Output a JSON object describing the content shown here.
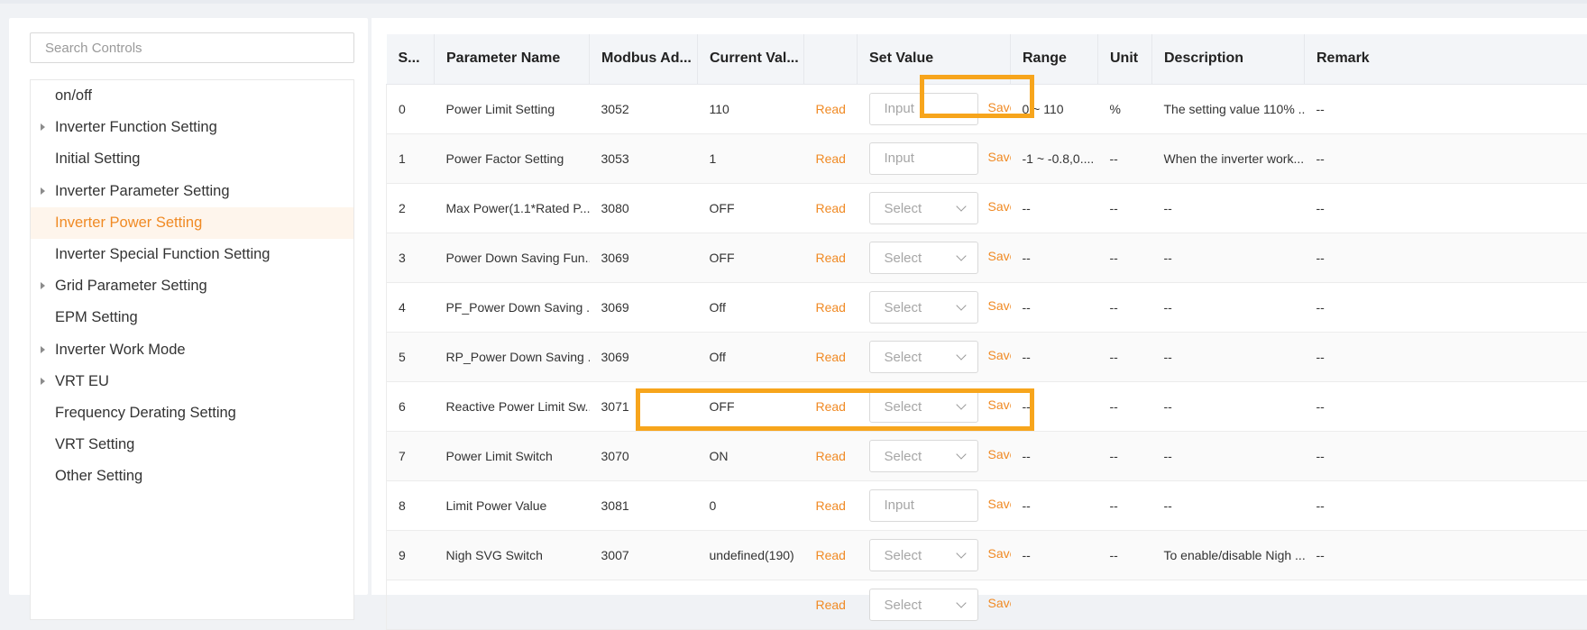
{
  "search": {
    "placeholder": "Search Controls"
  },
  "tree": [
    {
      "label": "on/off",
      "expandable": false,
      "active": false
    },
    {
      "label": "Inverter Function Setting",
      "expandable": true,
      "active": false
    },
    {
      "label": "Initial Setting",
      "expandable": false,
      "active": false
    },
    {
      "label": "Inverter Parameter Setting",
      "expandable": true,
      "active": false
    },
    {
      "label": "Inverter Power Setting",
      "expandable": false,
      "active": true
    },
    {
      "label": "Inverter Special Function Setting",
      "expandable": false,
      "active": false
    },
    {
      "label": "Grid Parameter Setting",
      "expandable": true,
      "active": false
    },
    {
      "label": "EPM Setting",
      "expandable": false,
      "active": false
    },
    {
      "label": "Inverter Work Mode",
      "expandable": true,
      "active": false
    },
    {
      "label": "VRT EU",
      "expandable": true,
      "active": false
    },
    {
      "label": "Frequency Derating Setting",
      "expandable": false,
      "active": false
    },
    {
      "label": "VRT Setting",
      "expandable": false,
      "active": false
    },
    {
      "label": "Other Setting",
      "expandable": false,
      "active": false
    }
  ],
  "table": {
    "headers": [
      "S...",
      "Parameter Name",
      "Modbus Ad...",
      "Current Val...",
      "",
      "Set Value",
      "Range",
      "Unit",
      "Description",
      "Remark"
    ],
    "read_label": "Read",
    "save_label": "Save",
    "input_placeholder": "Input",
    "select_placeholder": "Select",
    "rows": [
      {
        "sn": "0",
        "name": "Power Limit Setting",
        "addr": "3052",
        "current": "110",
        "control": "input",
        "range": "0 ~ 110",
        "unit": "%",
        "desc": "The setting value 110% ...",
        "remark": "--"
      },
      {
        "sn": "1",
        "name": "Power Factor Setting",
        "addr": "3053",
        "current": "1",
        "control": "input",
        "range": "-1 ~ -0.8,0....",
        "unit": "--",
        "desc": "When the inverter work...",
        "remark": "--"
      },
      {
        "sn": "2",
        "name": "Max Power(1.1*Rated P...",
        "addr": "3080",
        "current": "OFF",
        "control": "select",
        "range": "--",
        "unit": "--",
        "desc": "--",
        "remark": "--"
      },
      {
        "sn": "3",
        "name": "Power Down Saving Fun...",
        "addr": "3069",
        "current": "OFF",
        "control": "select",
        "range": "--",
        "unit": "--",
        "desc": "--",
        "remark": "--"
      },
      {
        "sn": "4",
        "name": "PF_Power Down Saving ...",
        "addr": "3069",
        "current": "Off",
        "control": "select",
        "range": "--",
        "unit": "--",
        "desc": "--",
        "remark": "--"
      },
      {
        "sn": "5",
        "name": "RP_Power Down Saving ...",
        "addr": "3069",
        "current": "Off",
        "control": "select",
        "range": "--",
        "unit": "--",
        "desc": "--",
        "remark": "--"
      },
      {
        "sn": "6",
        "name": "Reactive Power Limit Sw...",
        "addr": "3071",
        "current": "OFF",
        "control": "select",
        "range": "--",
        "unit": "--",
        "desc": "--",
        "remark": "--"
      },
      {
        "sn": "7",
        "name": "Power Limit Switch",
        "addr": "3070",
        "current": "ON",
        "control": "select",
        "range": "--",
        "unit": "--",
        "desc": "--",
        "remark": "--"
      },
      {
        "sn": "8",
        "name": "Limit Power Value",
        "addr": "3081",
        "current": "0",
        "control": "input",
        "range": "--",
        "unit": "--",
        "desc": "--",
        "remark": "--"
      },
      {
        "sn": "9",
        "name": "Nigh SVG Switch",
        "addr": "3007",
        "current": "undefined(190)",
        "control": "select",
        "range": "--",
        "unit": "--",
        "desc": "To enable/disable Nigh ...",
        "remark": "--"
      },
      {
        "sn": "",
        "name": "",
        "addr": "",
        "current": "",
        "control": "select",
        "range": "",
        "unit": "",
        "desc": "",
        "remark": ""
      }
    ]
  },
  "colors": {
    "accent": "#f08a24",
    "highlight": "#f7a51c",
    "active_bg": "#fef5ec"
  }
}
